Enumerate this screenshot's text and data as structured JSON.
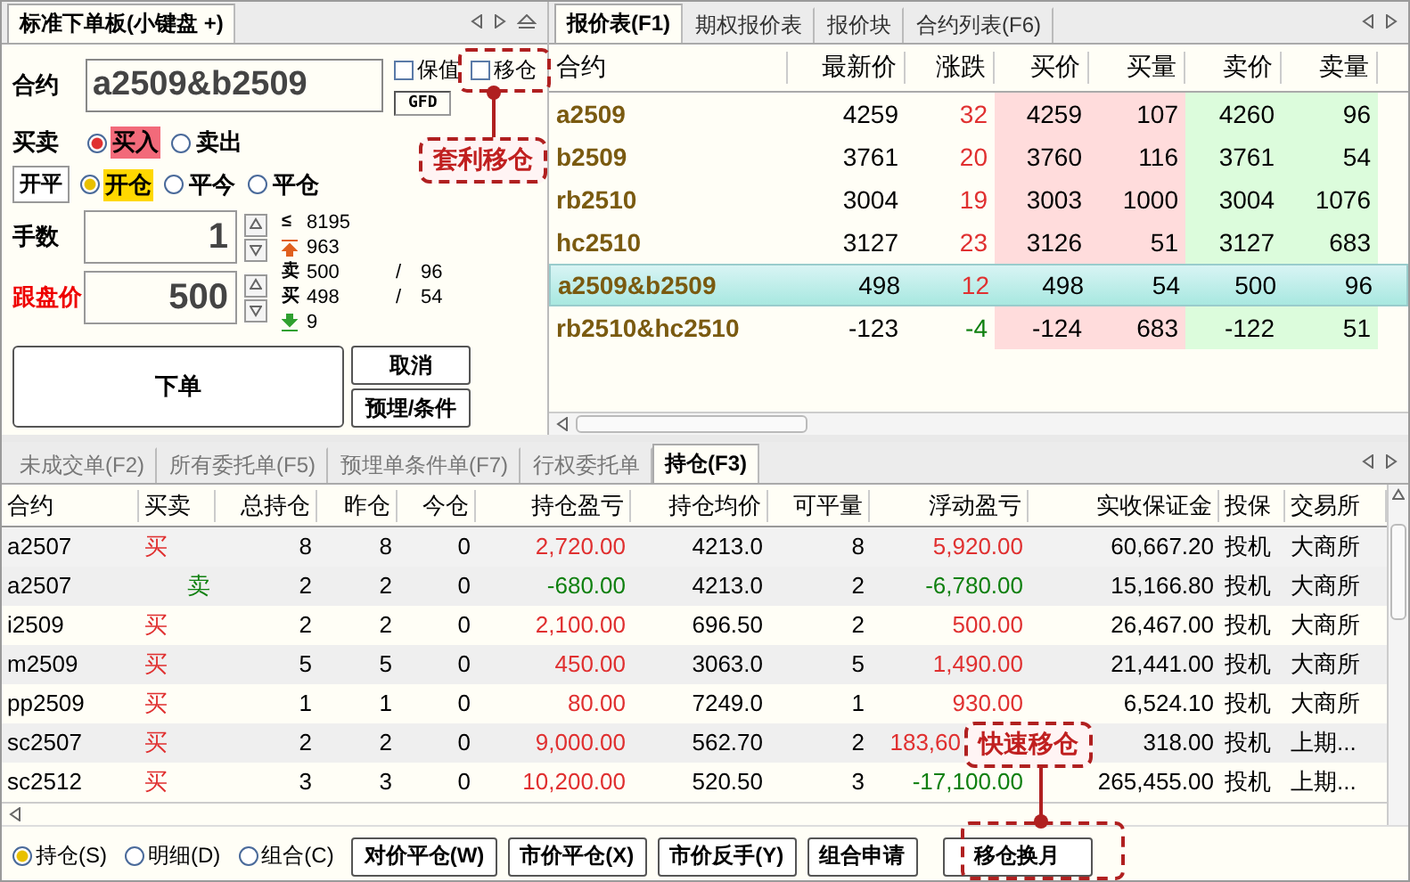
{
  "order_panel": {
    "tab": "标准下单板(小键盘 +)",
    "contract": {
      "label": "合约",
      "value": "a2509&b2509"
    },
    "checkboxes": [
      {
        "label": "保值",
        "checked": false
      },
      {
        "label": "移仓",
        "checked": false
      }
    ],
    "gfd": "GFD",
    "side": {
      "label": "买卖",
      "options": [
        {
          "label": "买入",
          "selected": true
        },
        {
          "label": "卖出",
          "selected": false
        }
      ]
    },
    "open_close": {
      "label": "开平",
      "options": [
        {
          "label": "开仓",
          "selected": true
        },
        {
          "label": "平今",
          "selected": false
        },
        {
          "label": "平仓",
          "selected": false
        }
      ]
    },
    "quantity": {
      "label": "手数",
      "value": "1"
    },
    "price": {
      "label": "跟盘价",
      "value": "500"
    },
    "info": [
      {
        "kind": "limit",
        "mark": "≤",
        "value": "8195"
      },
      {
        "kind": "up",
        "value": "963"
      },
      {
        "kind": "text",
        "mark": "卖",
        "value": "500",
        "sep": "/",
        "extra": "96"
      },
      {
        "kind": "text",
        "mark": "买",
        "value": "498",
        "sep": "/",
        "extra": "54"
      },
      {
        "kind": "down",
        "value": "9"
      }
    ],
    "buttons": {
      "submit": "下单",
      "cancel": "取消",
      "preset": "预埋/条件"
    }
  },
  "quote_panel": {
    "tabs": [
      {
        "label": "报价表(F1)",
        "selected": true
      },
      {
        "label": "期权报价表",
        "selected": false
      },
      {
        "label": "报价块",
        "selected": false
      },
      {
        "label": "合约列表(F6)",
        "selected": false
      }
    ],
    "columns": [
      "合约",
      "最新价",
      "涨跌",
      "买价",
      "买量",
      "卖价",
      "卖量"
    ],
    "rows": [
      {
        "cells": [
          "a2509",
          "4259",
          "32",
          "4259",
          "107",
          "4260",
          "96"
        ],
        "rising": true,
        "selected": false
      },
      {
        "cells": [
          "b2509",
          "3761",
          "20",
          "3760",
          "116",
          "3761",
          "54"
        ],
        "rising": true,
        "selected": false
      },
      {
        "cells": [
          "rb2510",
          "3004",
          "19",
          "3003",
          "1000",
          "3004",
          "1076"
        ],
        "rising": true,
        "selected": false
      },
      {
        "cells": [
          "hc2510",
          "3127",
          "23",
          "3126",
          "51",
          "3127",
          "683"
        ],
        "rising": true,
        "selected": false
      },
      {
        "cells": [
          "a2509&b2509",
          "498",
          "12",
          "498",
          "54",
          "500",
          "96"
        ],
        "rising": true,
        "selected": true
      },
      {
        "cells": [
          "rb2510&hc2510",
          "-123",
          "-4",
          "-124",
          "683",
          "-122",
          "51"
        ],
        "rising": false,
        "selected": false
      }
    ]
  },
  "positions_panel": {
    "tabs": [
      {
        "label": "未成交单(F2)",
        "selected": false
      },
      {
        "label": "所有委托单(F5)",
        "selected": false
      },
      {
        "label": "预埋单条件单(F7)",
        "selected": false
      },
      {
        "label": "行权委托单",
        "selected": false
      },
      {
        "label": "持仓(F3)",
        "selected": true
      }
    ],
    "columns": [
      "合约",
      "买卖",
      "总持仓",
      "昨仓",
      "今仓",
      "持仓盈亏",
      "持仓均价",
      "可平量",
      "浮动盈亏",
      "实收保证金",
      "投保",
      "交易所"
    ],
    "rows": [
      {
        "cells": [
          "a2507",
          "买",
          "8",
          "8",
          "0",
          "2,720.00",
          "4213.0",
          "8",
          "5,920.00",
          "60,667.20",
          "投机",
          "大商所"
        ],
        "short": false,
        "pnl_gain": true,
        "float_gain": true,
        "selected": true
      },
      {
        "cells": [
          "a2507",
          "卖",
          "2",
          "2",
          "0",
          "-680.00",
          "4213.0",
          "2",
          "-6,780.00",
          "15,166.80",
          "投机",
          "大商所"
        ],
        "short": true,
        "pnl_gain": false,
        "float_gain": false,
        "selected": false
      },
      {
        "cells": [
          "i2509",
          "买",
          "2",
          "2",
          "0",
          "2,100.00",
          "696.50",
          "2",
          "500.00",
          "26,467.00",
          "投机",
          "大商所"
        ],
        "short": false,
        "pnl_gain": true,
        "float_gain": true,
        "selected": false
      },
      {
        "cells": [
          "m2509",
          "买",
          "5",
          "5",
          "0",
          "450.00",
          "3063.0",
          "5",
          "1,490.00",
          "21,441.00",
          "投机",
          "大商所"
        ],
        "short": false,
        "pnl_gain": true,
        "float_gain": true,
        "selected": false
      },
      {
        "cells": [
          "pp2509",
          "买",
          "1",
          "1",
          "0",
          "80.00",
          "7249.0",
          "1",
          "930.00",
          "6,524.10",
          "投机",
          "大商所"
        ],
        "short": false,
        "pnl_gain": true,
        "float_gain": true,
        "selected": false
      },
      {
        "cells": [
          "sc2507",
          "买",
          "2",
          "2",
          "0",
          "9,000.00",
          "562.70",
          "2",
          "183,60",
          "318.00",
          "投机",
          "上期..."
        ],
        "short": false,
        "pnl_gain": true,
        "float_gain": true,
        "overlaid": true,
        "selected": false
      },
      {
        "cells": [
          "sc2512",
          "买",
          "3",
          "3",
          "0",
          "10,200.00",
          "520.50",
          "3",
          "-17,100.00",
          "265,455.00",
          "投机",
          "上期..."
        ],
        "short": false,
        "pnl_gain": true,
        "float_gain": false,
        "selected": false
      }
    ],
    "view_options": [
      {
        "label": "持仓(S)",
        "selected": true
      },
      {
        "label": "明细(D)",
        "selected": false
      },
      {
        "label": "组合(C)",
        "selected": false
      }
    ],
    "buttons": [
      "对价平仓(W)",
      "市价平仓(X)",
      "市价反手(Y)",
      "组合申请",
      "移仓换月"
    ]
  },
  "callouts": [
    {
      "text": "套利移仓"
    },
    {
      "text": "快速移仓"
    }
  ]
}
